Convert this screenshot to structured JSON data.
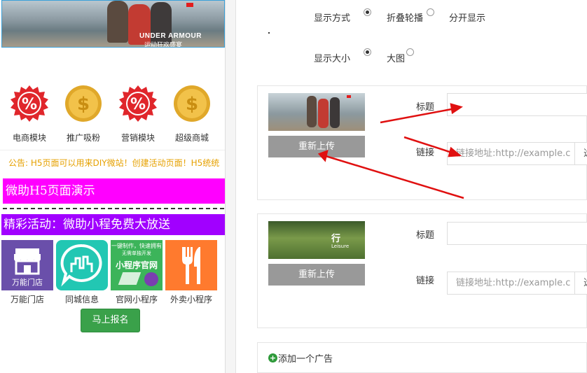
{
  "preview": {
    "banner": {
      "brand": "UNDER ARMOUR",
      "brand_sub": "运动狂欢盛宴"
    },
    "icons": [
      {
        "label": "电商模块",
        "icon": "percent-badge-icon"
      },
      {
        "label": "推广吸粉",
        "icon": "dollar-coin-icon"
      },
      {
        "label": "营销模块",
        "icon": "percent-badge-icon"
      },
      {
        "label": "超级商城",
        "icon": "dollar-coin-icon"
      }
    ],
    "notice": "公告: H5页面可以用来DIY微站！创建活动页面！H5统统",
    "title_bar": "微助H5页面演示",
    "promo_bar": "精彩活动：微助小程免费大放送",
    "apps": [
      {
        "label": "万能门店",
        "tile_text": "万能门店"
      },
      {
        "label": "同城信息",
        "tile_text": ""
      },
      {
        "label": "官网小程序",
        "tile_text": "小程序官网",
        "tile_top": "一键制作，快速拥有",
        "tile_sub": "无需单独开发"
      },
      {
        "label": "外卖小程序",
        "tile_text": ""
      }
    ],
    "signup_label": "马上报名"
  },
  "settings": {
    "display_mode": {
      "label": "显示方式",
      "options": [
        {
          "label": "折叠轮播",
          "checked": true
        },
        {
          "label": "分开显示",
          "checked": false
        }
      ]
    },
    "display_size": {
      "label": "显示大小",
      "options": [
        {
          "label": "大图",
          "checked": true
        },
        {
          "label": "",
          "checked": false
        }
      ]
    },
    "ads": [
      {
        "reupload_label": "重新上传",
        "title_label": "标题",
        "title_value": "",
        "link_label": "链接",
        "link_placeholder": "链接地址:http://example.c",
        "link_addon": "选"
      },
      {
        "reupload_label": "重新上传",
        "title_label": "标题",
        "title_value": "",
        "link_label": "链接",
        "link_placeholder": "链接地址:http://example.c",
        "link_addon": "选",
        "thumb_text": "行",
        "thumb_sub": "Leisure"
      }
    ],
    "add_ad_label": "添加一个广告"
  },
  "colors": {
    "magenta": "#ff00ff",
    "purple": "#a100ff",
    "notice": "#e6a100",
    "signup": "#3aa14a",
    "arrow": "#e01010"
  }
}
